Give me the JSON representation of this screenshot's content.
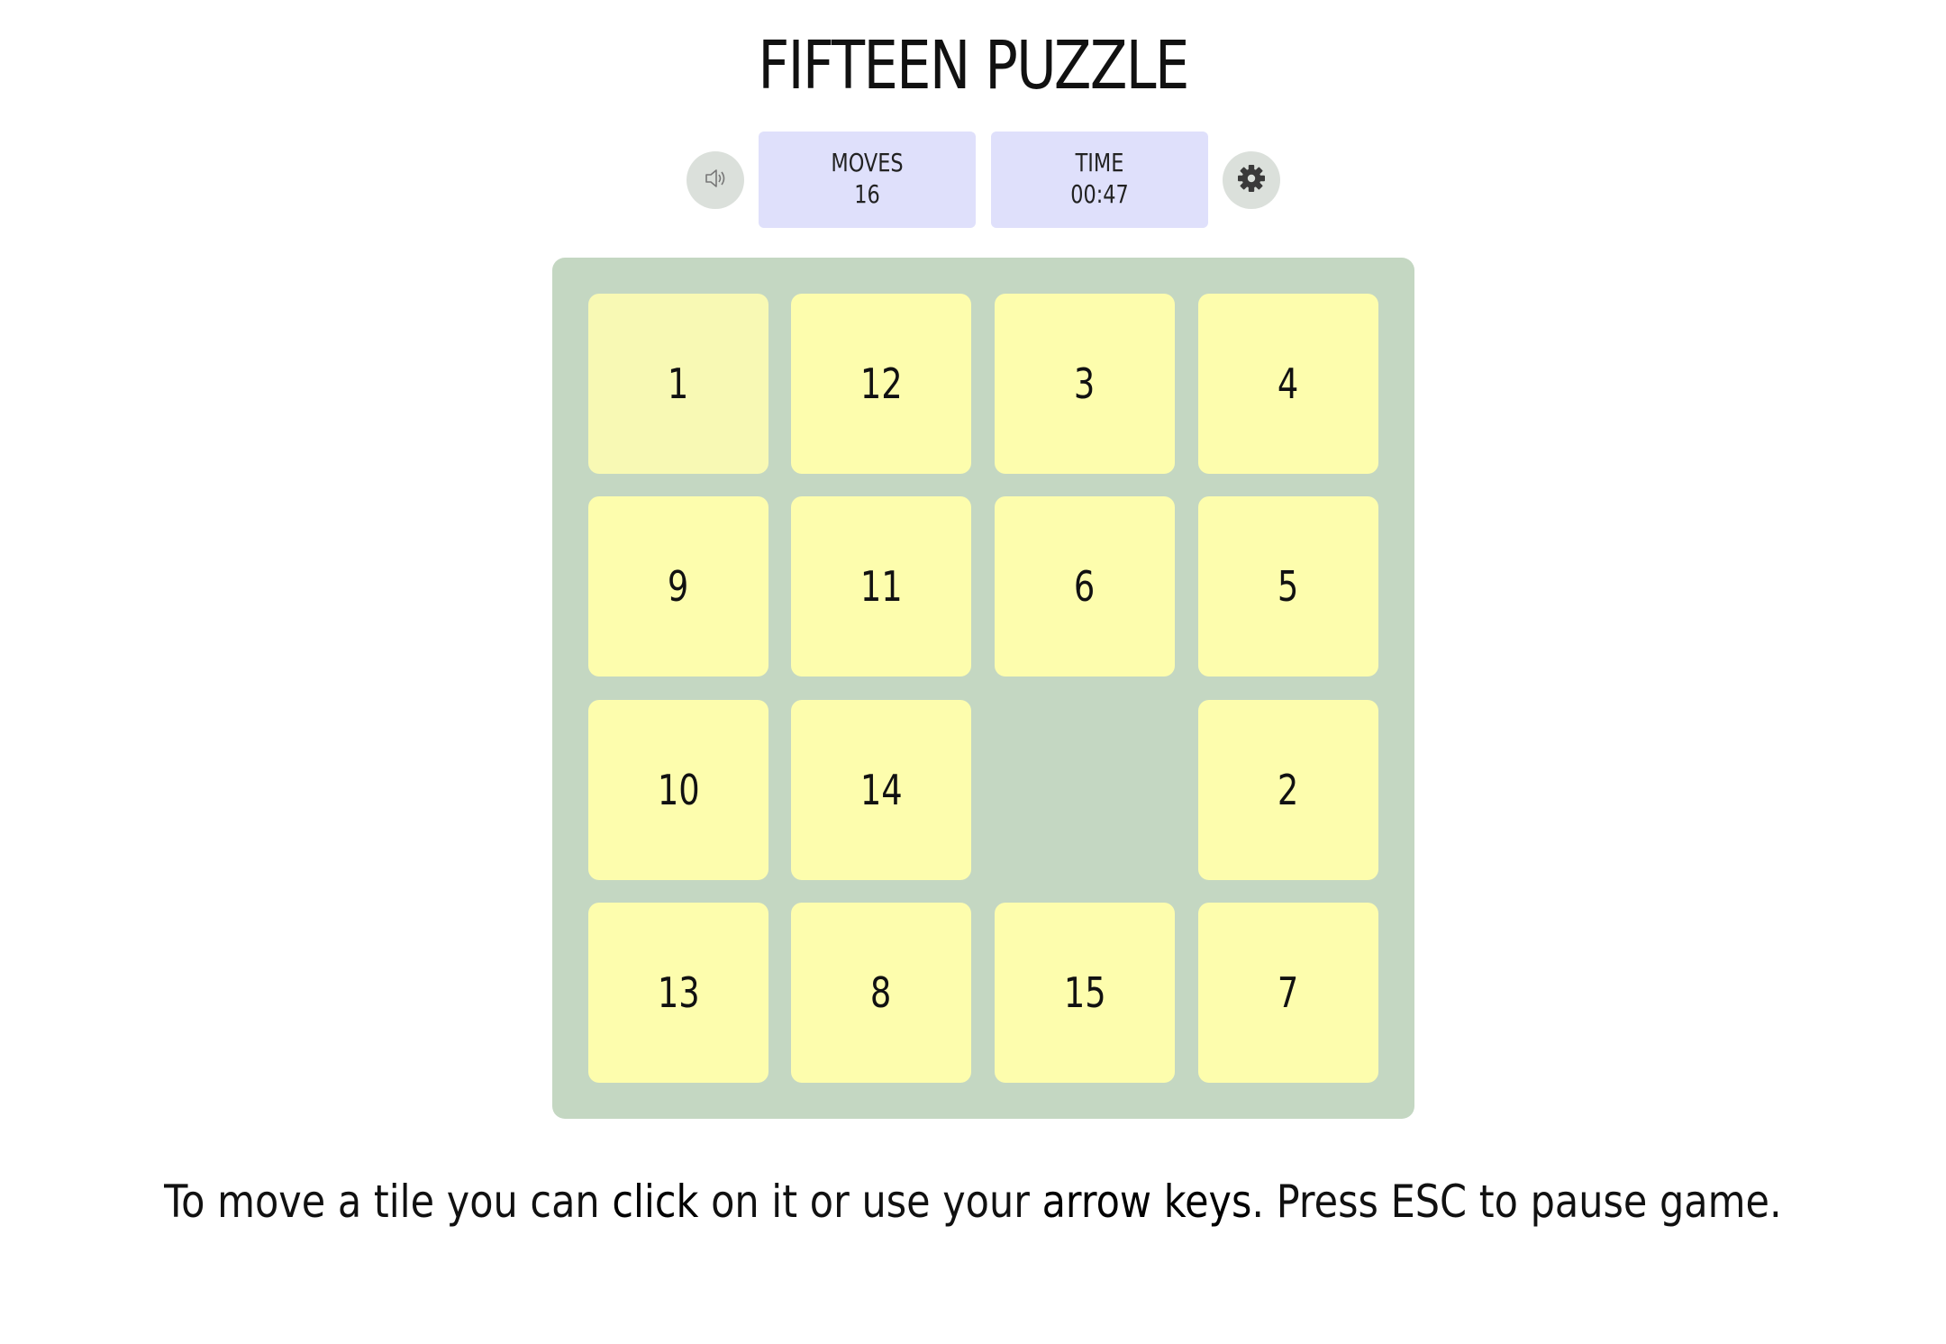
{
  "title": "FIFTEEN PUZZLE",
  "controls": {
    "sound_icon": "speaker-icon",
    "settings_icon": "gear-icon"
  },
  "stats": {
    "moves_label": "MOVES",
    "moves_value": "16",
    "time_label": "TIME",
    "time_value": "00:47"
  },
  "colors": {
    "board": "#c4d7c2",
    "tile": "#fdfdad",
    "tile_correct": "#f8f9b4",
    "stat_box": "#dfe0fb",
    "round_button": "#dbe0db"
  },
  "board": {
    "rows": [
      [
        "1",
        "12",
        "3",
        "4"
      ],
      [
        "9",
        "11",
        "6",
        "5"
      ],
      [
        "10",
        "14",
        "",
        "2"
      ],
      [
        "13",
        "8",
        "15",
        "7"
      ]
    ]
  },
  "instructions": {
    "part1": "To move a tile you can ",
    "click": "click",
    "part2": " on it or use your ",
    "arrow_keys": "arrow keys",
    "part3": ". Press ESC to pause game."
  }
}
